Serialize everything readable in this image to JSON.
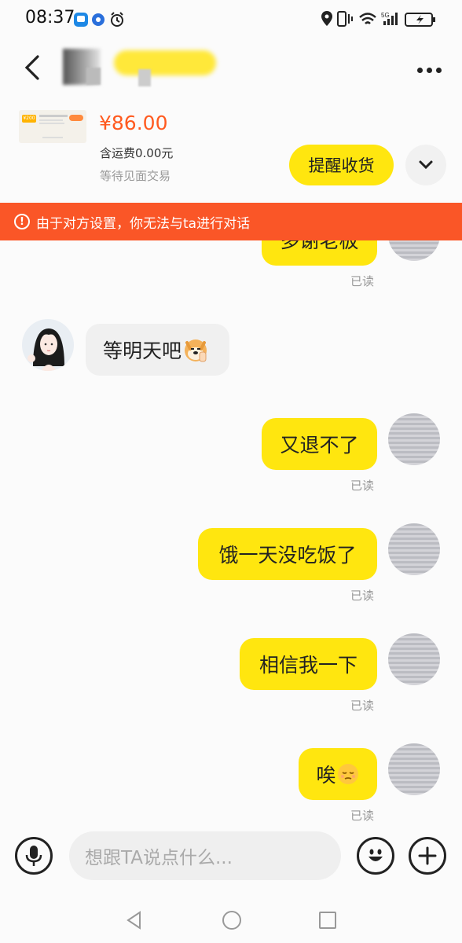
{
  "status_bar": {
    "time": "08:37",
    "network": "5G"
  },
  "header": {
    "contact_name_censored": true
  },
  "product": {
    "price": "¥86.00",
    "shipping": "含运费0.00元",
    "trade_status": "等待见面交易",
    "remind_label": "提醒收货",
    "thumb_tag": "¥200"
  },
  "banner": {
    "icon": "!",
    "text": "由于对方设置，你无法与ta进行对话"
  },
  "messages": [
    {
      "from": "me",
      "text": "多谢老板",
      "read": "已读"
    },
    {
      "from": "other",
      "text": "等明天吧",
      "emoji": "doge-emoji"
    },
    {
      "from": "me",
      "text": "又退不了",
      "read": "已读"
    },
    {
      "from": "me",
      "text": "饿一天没吃饭了",
      "read": "已读"
    },
    {
      "from": "me",
      "text": "相信我一下",
      "read": "已读"
    },
    {
      "from": "me",
      "text": "唉",
      "emoji": "sad-face-emoji",
      "read": "已读"
    }
  ],
  "input": {
    "placeholder": "想跟TA说点什么..."
  },
  "colors": {
    "accent": "#ffe60f",
    "banner": "#fa5627",
    "price": "#ff5a1f"
  }
}
